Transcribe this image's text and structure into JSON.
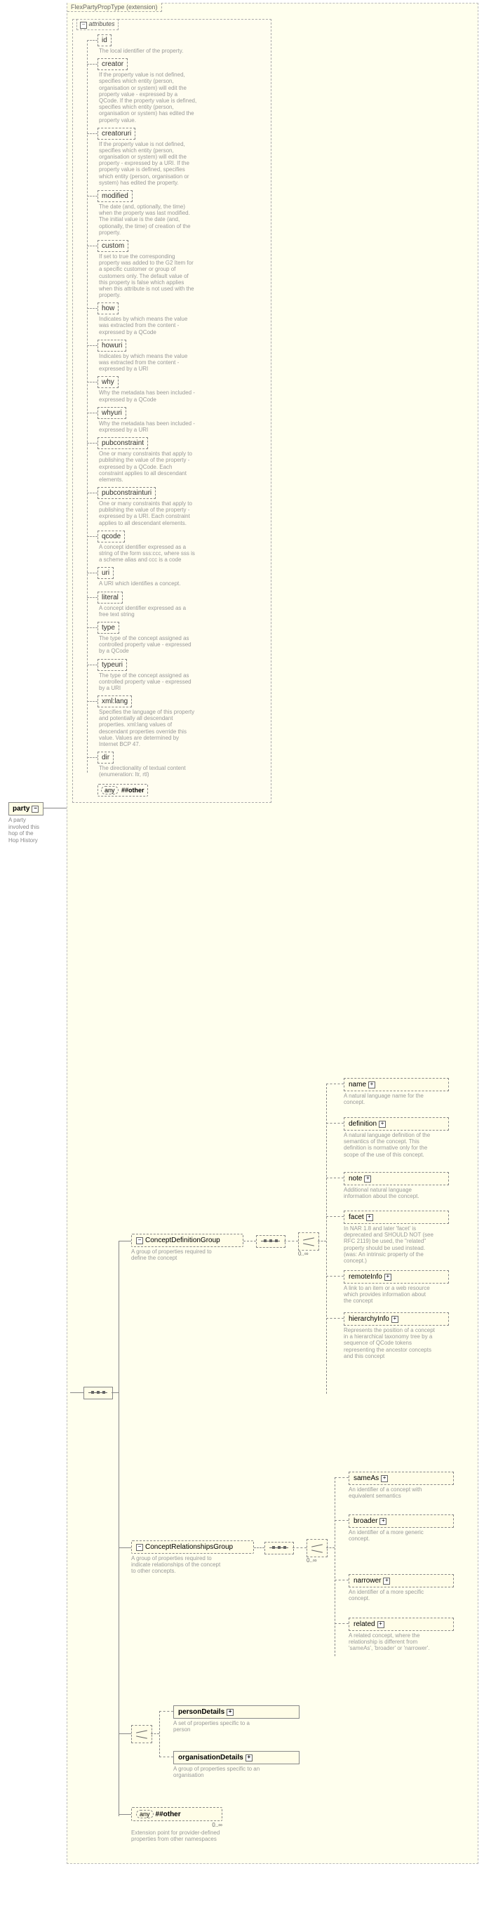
{
  "extension_label": "FlexPartyPropType (extension)",
  "root": {
    "name": "party",
    "desc": "A party involved this hop of the Hop History"
  },
  "attributes_title": "attributes",
  "attributes": [
    {
      "name": "id",
      "desc": "The local identifier of the property."
    },
    {
      "name": "creator",
      "desc": "If the property value is not defined, specifies which entity (person, organisation or system) will edit the property value - expressed by a QCode. If the property value is defined, specifies which entity (person, organisation or system) has edited the property value."
    },
    {
      "name": "creatoruri",
      "desc": "If the property value is not defined, specifies which entity (person, organisation or system) will edit the property - expressed by a URI. If the property value is defined, specifies which entity (person, organisation or system) has edited the property."
    },
    {
      "name": "modified",
      "desc": "The date (and, optionally, the time) when the property was last modified. The initial value is the date (and, optionally, the time) of creation of the property."
    },
    {
      "name": "custom",
      "desc": "If set to true the corresponding property was added to the G2 Item for a specific customer or group of customers only. The default value of this property is false which applies when this attribute is not used with the property."
    },
    {
      "name": "how",
      "desc": "Indicates by which means the value was extracted from the content - expressed by a QCode"
    },
    {
      "name": "howuri",
      "desc": "Indicates by which means the value was extracted from the content - expressed by a URI"
    },
    {
      "name": "why",
      "desc": "Why the metadata has been included - expressed by a QCode"
    },
    {
      "name": "whyuri",
      "desc": "Why the metadata has been included - expressed by a URI"
    },
    {
      "name": "pubconstraint",
      "desc": "One or many constraints that apply to publishing the value of the property - expressed by a QCode. Each constraint applies to all descendant elements."
    },
    {
      "name": "pubconstrainturi",
      "desc": "One or many constraints that apply to publishing the value of the property - expressed by a URI. Each constraint applies to all descendant elements."
    },
    {
      "name": "qcode",
      "desc": "A concept identifier expressed as a string of the form sss:ccc, where sss is a scheme alias and ccc is a code"
    },
    {
      "name": "uri",
      "desc": "A URI which identifies a concept."
    },
    {
      "name": "literal",
      "desc": "A concept identifier expressed as a free text string"
    },
    {
      "name": "type",
      "desc": "The type of the concept assigned as controlled property value - expressed by a QCode"
    },
    {
      "name": "typeuri",
      "desc": "The type of the concept assigned as controlled property value - expressed by a URI"
    },
    {
      "name": "xml:lang",
      "desc": "Specifies the language of this property and potentially all descendant properties. xml:lang values of descendant properties override this value. Values are determined by Internet BCP 47."
    },
    {
      "name": "dir",
      "desc": "The directionality of textual content (enumeration: ltr, rtl)"
    }
  ],
  "any_other_label_any": "any",
  "any_other_label_hash": "##other",
  "groups": {
    "cdg": {
      "name": "ConceptDefinitionGroup",
      "desc": "A group of properties required to define the concept",
      "mult": "0..∞",
      "children": [
        {
          "name": "name",
          "desc": "A natural language name for the concept."
        },
        {
          "name": "definition",
          "desc": "A natural language definition of the semantics of the concept. This definition is normative only for the scope of the use of this concept."
        },
        {
          "name": "note",
          "desc": "Additional natural language information about the concept."
        },
        {
          "name": "facet",
          "desc": "In NAR 1.8 and later 'facet' is deprecated and SHOULD NOT (see RFC 2119) be used, the \"related\" property should be used instead. (was: An intrinsic property of the concept.)"
        },
        {
          "name": "remoteInfo",
          "desc": "A link to an item or a web resource which provides information about the concept"
        },
        {
          "name": "hierarchyInfo",
          "desc": "Represents the position of a concept in a hierarchical taxonomy tree by a sequence of QCode tokens representing the ancestor concepts and this concept"
        }
      ]
    },
    "crg": {
      "name": "ConceptRelationshipsGroup",
      "desc": "A group of properties required to indicate relationships of the concept to other concepts.",
      "mult": "0..∞",
      "children": [
        {
          "name": "sameAs",
          "desc": "An identifier of a concept with equivalent semantics"
        },
        {
          "name": "broader",
          "desc": "An identifier of a more generic concept."
        },
        {
          "name": "narrower",
          "desc": "An identifier of a more specific concept."
        },
        {
          "name": "related",
          "desc": "A related concept, where the relationship is different from 'sameAs', 'broader' or 'narrower'."
        }
      ]
    },
    "details": [
      {
        "name": "personDetails",
        "desc": "A set of properties specific to a person"
      },
      {
        "name": "organisationDetails",
        "desc": "A group of properties specific to an organisation"
      }
    ]
  },
  "wildcard": {
    "label_any": "any",
    "label_hash": "##other",
    "desc": "Extension point for provider-defined properties from other namespaces",
    "mult": "0..∞"
  }
}
